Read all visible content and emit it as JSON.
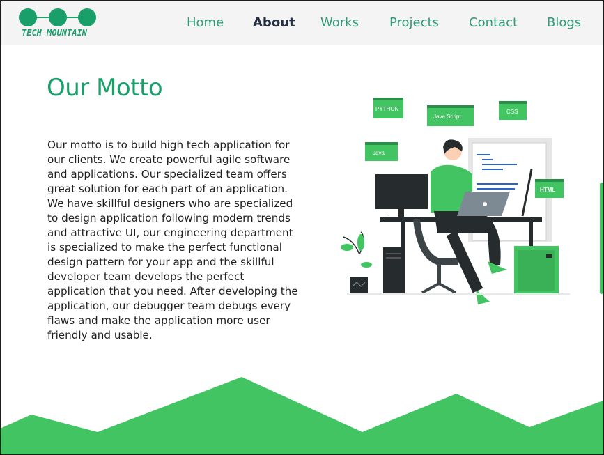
{
  "brand": {
    "name": "TECH MOUNTAIN",
    "color": "#1a9f6a"
  },
  "nav": {
    "items": [
      {
        "label": "Home",
        "active": false
      },
      {
        "label": "About",
        "active": true
      },
      {
        "label": "Works",
        "active": false
      },
      {
        "label": "Projects",
        "active": false
      },
      {
        "label": "Contact",
        "active": false
      },
      {
        "label": "Blogs",
        "active": false
      }
    ]
  },
  "main": {
    "title": "Our Motto",
    "body": "Our motto is to build high tech application for our clients. We create powerful agile software and applications. Our specialized team offers great solution for each part of an application. We have skillful designers who are specialized to design application following modern trends and attractive UI, our engineering department is specialized to make the perfect functional design pattern for your app and the skillful developer team develops the perfect application that you need. After developing the application, our debugger team debugs every flaws and make the application more user friendly and usable."
  },
  "illustration": {
    "tags": [
      "PYTHON",
      "Java Script",
      "CSS",
      "Java",
      "HTML"
    ]
  },
  "colors": {
    "accent": "#43c462",
    "title": "#1a9f6a",
    "nav": "#2f9a77",
    "nav_active": "#243044",
    "text": "#1f1f1f"
  }
}
